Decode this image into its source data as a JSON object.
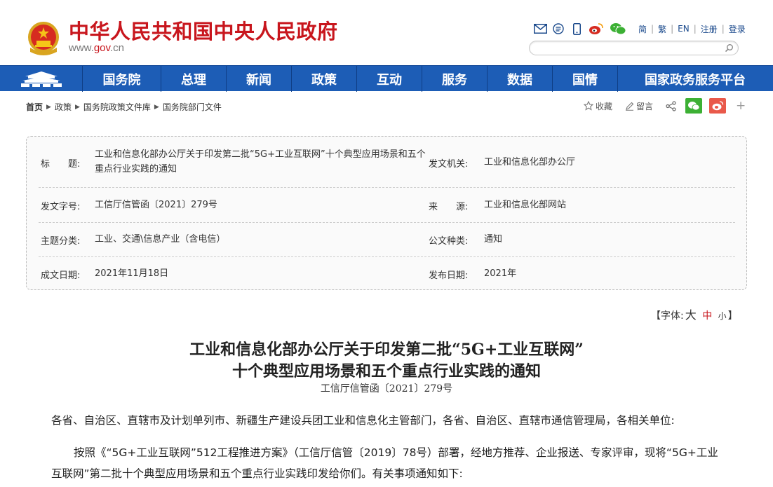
{
  "header": {
    "site_title": "中华人民共和国中央人民政府",
    "site_url_prefix": "www.",
    "site_url_brand": "gov",
    "site_url_suffix": ".cn",
    "tools": [
      "mail-icon",
      "rss-icon",
      "mobile-icon",
      "weibo-icon",
      "wechat-icon"
    ],
    "links": [
      "简",
      "繁",
      "EN",
      "注册",
      "登录"
    ],
    "search_placeholder": ""
  },
  "nav": {
    "items": [
      "国务院",
      "总理",
      "新闻",
      "政策",
      "互动",
      "服务",
      "数据",
      "国情",
      "国家政务服务平台"
    ]
  },
  "breadcrumb": {
    "items": [
      "首页",
      "政策",
      "国务院政策文件库",
      "国务院部门文件"
    ]
  },
  "share": {
    "favorite_label": "收藏",
    "comment_label": "留言"
  },
  "info": {
    "title_label": "标　　题:",
    "title_value": "工业和信息化部办公厅关于印发第二批“5G+工业互联网”十个典型应用场景和五个重点行业实践的通知",
    "issuer_label": "发文机关:",
    "issuer_value": "工业和信息化部办公厅",
    "docno_label": "发文字号:",
    "docno_value": "工信厅信管函〔2021〕279号",
    "source_label": "来　　源:",
    "source_value": "工业和信息化部网站",
    "topic_label": "主题分类:",
    "topic_value": "工业、交通\\信息产业（含电信）",
    "doctype_label": "公文种类:",
    "doctype_value": "通知",
    "written_label": "成文日期:",
    "written_value": "2021年11月18日",
    "published_label": "发布日期:",
    "published_value": "2021年"
  },
  "fontsize": {
    "prefix": "【字体:",
    "big": "大",
    "mid": "中",
    "small": "小",
    "suffix": "】"
  },
  "article": {
    "title_line1": "工业和信息化部办公厅关于印发第二批“5G+工业互联网”",
    "title_line2": "十个典型应用场景和五个重点行业实践的通知",
    "doc_no": "工信厅信管函〔2021〕279号",
    "salutation": "各省、自治区、直辖市及计划单列市、新疆生产建设兵团工业和信息化主管部门，各省、自治区、直辖市通信管理局，各相关单位:",
    "para1_line1": "按照《“5G+工业互联网”512工程推进方案》（工信厅信管〔2019〕78号）部署，经地方推荐、企业报送、专家评审，现将“5G+工业",
    "para1_line2": "互联网”第二批十个典型应用场景和五个重点行业实践印发给你们。有关事项通知如下:"
  },
  "colors": {
    "brand_red": "#c8161d",
    "nav_blue": "#1d5db6",
    "link_blue": "#1b4a8c"
  }
}
